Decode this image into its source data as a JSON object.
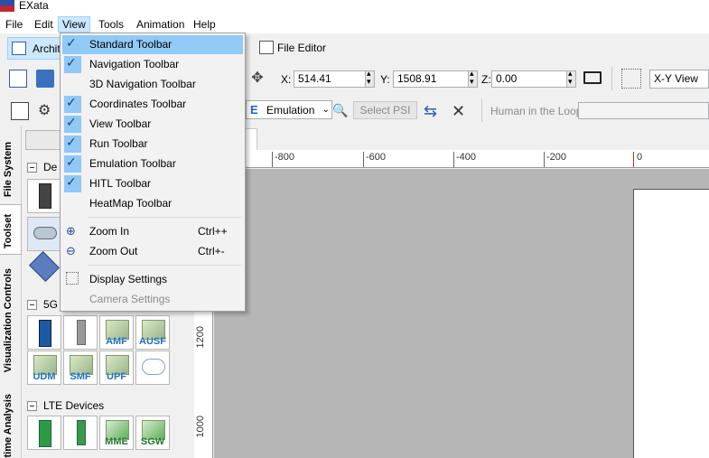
{
  "window": {
    "title": "EXata"
  },
  "menubar": {
    "items": [
      "File",
      "Edit",
      "View",
      "Tools",
      "Animation",
      "Help"
    ]
  },
  "toolbar1": {
    "architect_label": "Archit",
    "file_editor_label": "File Editor"
  },
  "coords": {
    "x_label": "X:",
    "x_value": "514.41",
    "y_label": "Y:",
    "y_value": "1508.91",
    "z_label": "Z:",
    "z_value": "0.00",
    "view_mode": "X-Y View"
  },
  "run_toolbar": {
    "emulation_label": "Emulation",
    "select_psi_label": "Select PSI",
    "hitl_label": "Human in the Loop:"
  },
  "side_tabs": [
    "File System",
    "Toolset",
    "Visualization Controls",
    "time Analysis"
  ],
  "toolset": {
    "sections": [
      {
        "label": "De"
      },
      {
        "label": "5G"
      },
      {
        "label": "LTE Devices"
      }
    ],
    "five_g_tools": [
      "",
      "",
      "AMF",
      "AUSF",
      "UDM",
      "SMF",
      "UPF",
      ""
    ],
    "lte_tools": [
      "",
      "",
      "MME",
      "SGW"
    ]
  },
  "canvas": {
    "tab_label": "1",
    "hruler_labels": [
      "-800",
      "-600",
      "-400",
      "-200",
      "0"
    ],
    "vruler_labels": [
      "1200",
      "1000"
    ]
  },
  "view_menu": {
    "items": [
      {
        "label": "Standard Toolbar",
        "checked": true,
        "highlighted": true
      },
      {
        "label": "Navigation Toolbar",
        "checked": true
      },
      {
        "label": "3D Navigation Toolbar",
        "checked": false
      },
      {
        "label": "Coordinates Toolbar",
        "checked": true
      },
      {
        "label": "View Toolbar",
        "checked": true
      },
      {
        "label": "Run Toolbar",
        "checked": true
      },
      {
        "label": "Emulation Toolbar",
        "checked": true
      },
      {
        "label": "HITL Toolbar",
        "checked": true
      },
      {
        "label": "HeatMap Toolbar",
        "checked": false
      }
    ],
    "zoom_in": {
      "label": "Zoom In",
      "shortcut": "Ctrl++"
    },
    "zoom_out": {
      "label": "Zoom Out",
      "shortcut": "Ctrl+-"
    },
    "display_settings": "Display Settings",
    "camera_settings": "Camera Settings"
  },
  "colors": {
    "menu_highlight": "#91c9f7",
    "check_bg": "#90c8f6",
    "canvas_gray": "#b6b6b6"
  }
}
